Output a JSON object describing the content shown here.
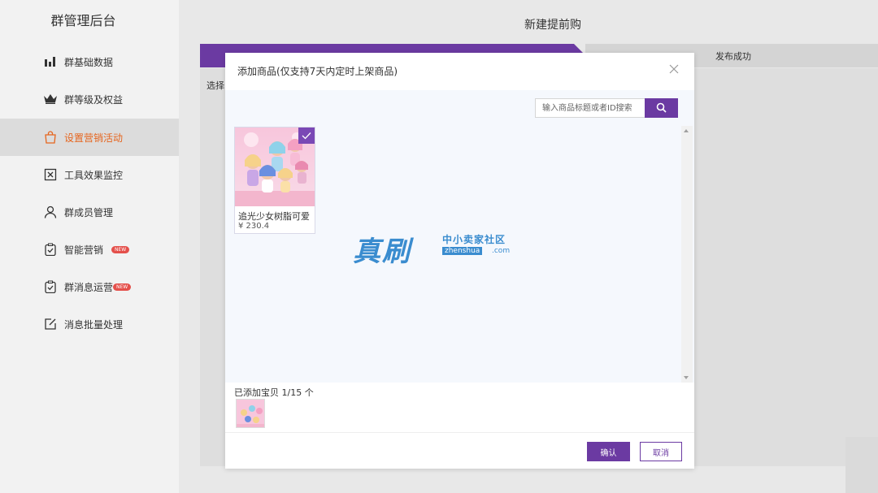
{
  "sidebar": {
    "title": "群管理后台",
    "items": [
      {
        "label": "群基础数据",
        "icon": "bar-chart-icon"
      },
      {
        "label": "群等级及权益",
        "icon": "crown-icon"
      },
      {
        "label": "设置营销活动",
        "icon": "shopping-bag-icon",
        "active": true
      },
      {
        "label": "工具效果监控",
        "icon": "monitor-icon"
      },
      {
        "label": "群成员管理",
        "icon": "user-icon"
      },
      {
        "label": "智能营销",
        "icon": "clipboard-check-icon",
        "badge": "NEW"
      },
      {
        "label": "群消息运营",
        "icon": "clipboard-check-icon",
        "badge": "NEW"
      },
      {
        "label": "消息批量处理",
        "icon": "edit-icon"
      }
    ]
  },
  "main": {
    "page_title": "新建提前购",
    "steps": {
      "last": "发布成功"
    },
    "behind_text": "选择"
  },
  "modal": {
    "title": "添加商品(仅支持7天内定时上架商品)",
    "search_placeholder": "输入商品标题或者ID搜索",
    "product": {
      "name": "追光少女树脂可爱",
      "price": "¥ 230.4",
      "selected": true
    },
    "added_label": "已添加宝贝 1/15 个",
    "confirm_label": "确认",
    "cancel_label": "取消"
  },
  "watermark": {
    "big": "真刷",
    "small": "中小卖家社区",
    "domain": "zhenshua",
    "tld": ".com"
  },
  "colors": {
    "accent": "#6b3aa2",
    "active_nav": "#e6651e",
    "badge": "#e4504b",
    "watermark": "#3a8ccf"
  }
}
